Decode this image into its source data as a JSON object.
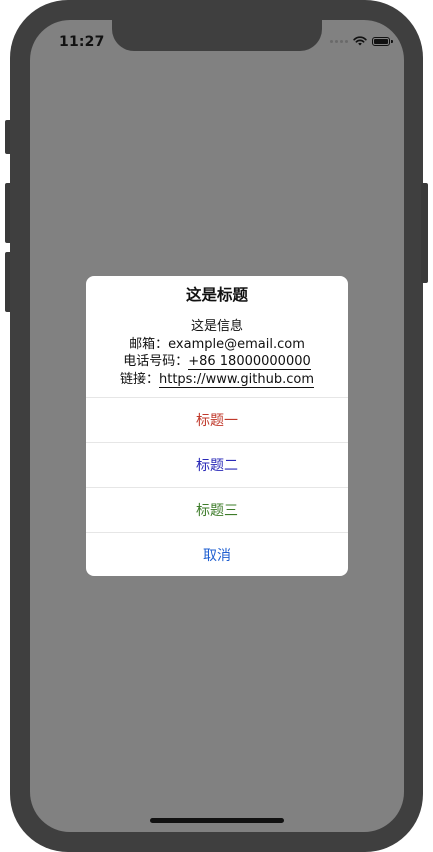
{
  "status_bar": {
    "time": "11:27"
  },
  "alert": {
    "title": "这是标题",
    "message_line1": "这是信息",
    "email_label": "邮箱：",
    "email_value": "example@email.com",
    "phone_label": "电话号码：",
    "phone_value": "+86 18000000000",
    "link_label": "链接：",
    "link_value": "https://www.github.com",
    "actions": [
      {
        "label": "标题一",
        "color": "#c0392b"
      },
      {
        "label": "标题二",
        "color": "#2a2ab8"
      },
      {
        "label": "标题三",
        "color": "#3e7c2a"
      },
      {
        "label": "取消",
        "color": "#1f5fd1"
      }
    ]
  },
  "colors": {
    "overlay": "#818181",
    "device_frame": "#3f3f3f"
  },
  "icons": [
    "signal-dots-icon",
    "wifi-icon",
    "battery-icon"
  ]
}
